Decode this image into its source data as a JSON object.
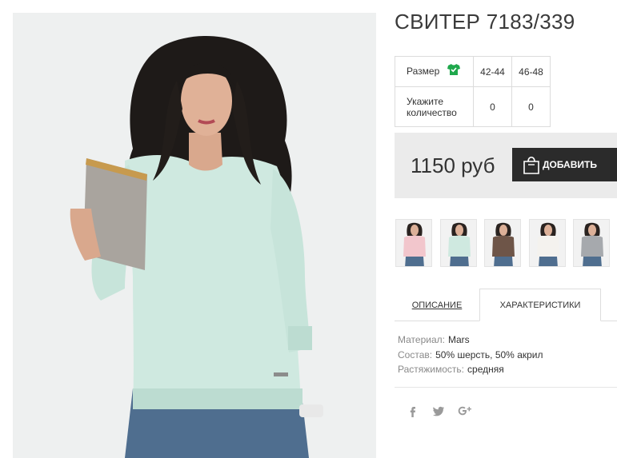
{
  "product": {
    "title": "СВИТЕР 7183/339"
  },
  "size_table": {
    "size_label": "Размер",
    "size_icon": "tshirt-icon",
    "quantity_label": "Укажите количество",
    "sizes": [
      "42-44",
      "46-48"
    ],
    "quantities": [
      "0",
      "0"
    ]
  },
  "buy": {
    "price": "1150 руб",
    "add_label": "ДОБАВИТЬ",
    "add_icon": "shopping-bag-icon"
  },
  "thumbnails": [
    {
      "color_name": "pink",
      "sweater_color": "#f2c6cc"
    },
    {
      "color_name": "mint",
      "sweater_color": "#cfe9e0"
    },
    {
      "color_name": "brown",
      "sweater_color": "#6e5548"
    },
    {
      "color_name": "white",
      "sweater_color": "#f4f2ee"
    },
    {
      "color_name": "grey",
      "sweater_color": "#a6a9ad"
    }
  ],
  "tabs": {
    "description": "ОПИСАНИЕ",
    "characteristics": "ХАРАКТЕРИСТИКИ",
    "active": "characteristics"
  },
  "specs": [
    {
      "key": "Материал:",
      "value": "Mars"
    },
    {
      "key": "Состав:",
      "value": "50% шерсть, 50% акрил"
    },
    {
      "key": "Растяжимость:",
      "value": "средняя"
    }
  ],
  "social": [
    {
      "name": "facebook-icon",
      "glyph": "f"
    },
    {
      "name": "twitter-icon",
      "glyph": "🐦"
    },
    {
      "name": "google-plus-icon",
      "glyph": "g+"
    }
  ],
  "colors": {
    "icon_green": "#1fa84c",
    "button_dark": "#2b2b2b",
    "buybox_bg": "#ebebeb",
    "main_sweater": "#cfe9e0"
  }
}
